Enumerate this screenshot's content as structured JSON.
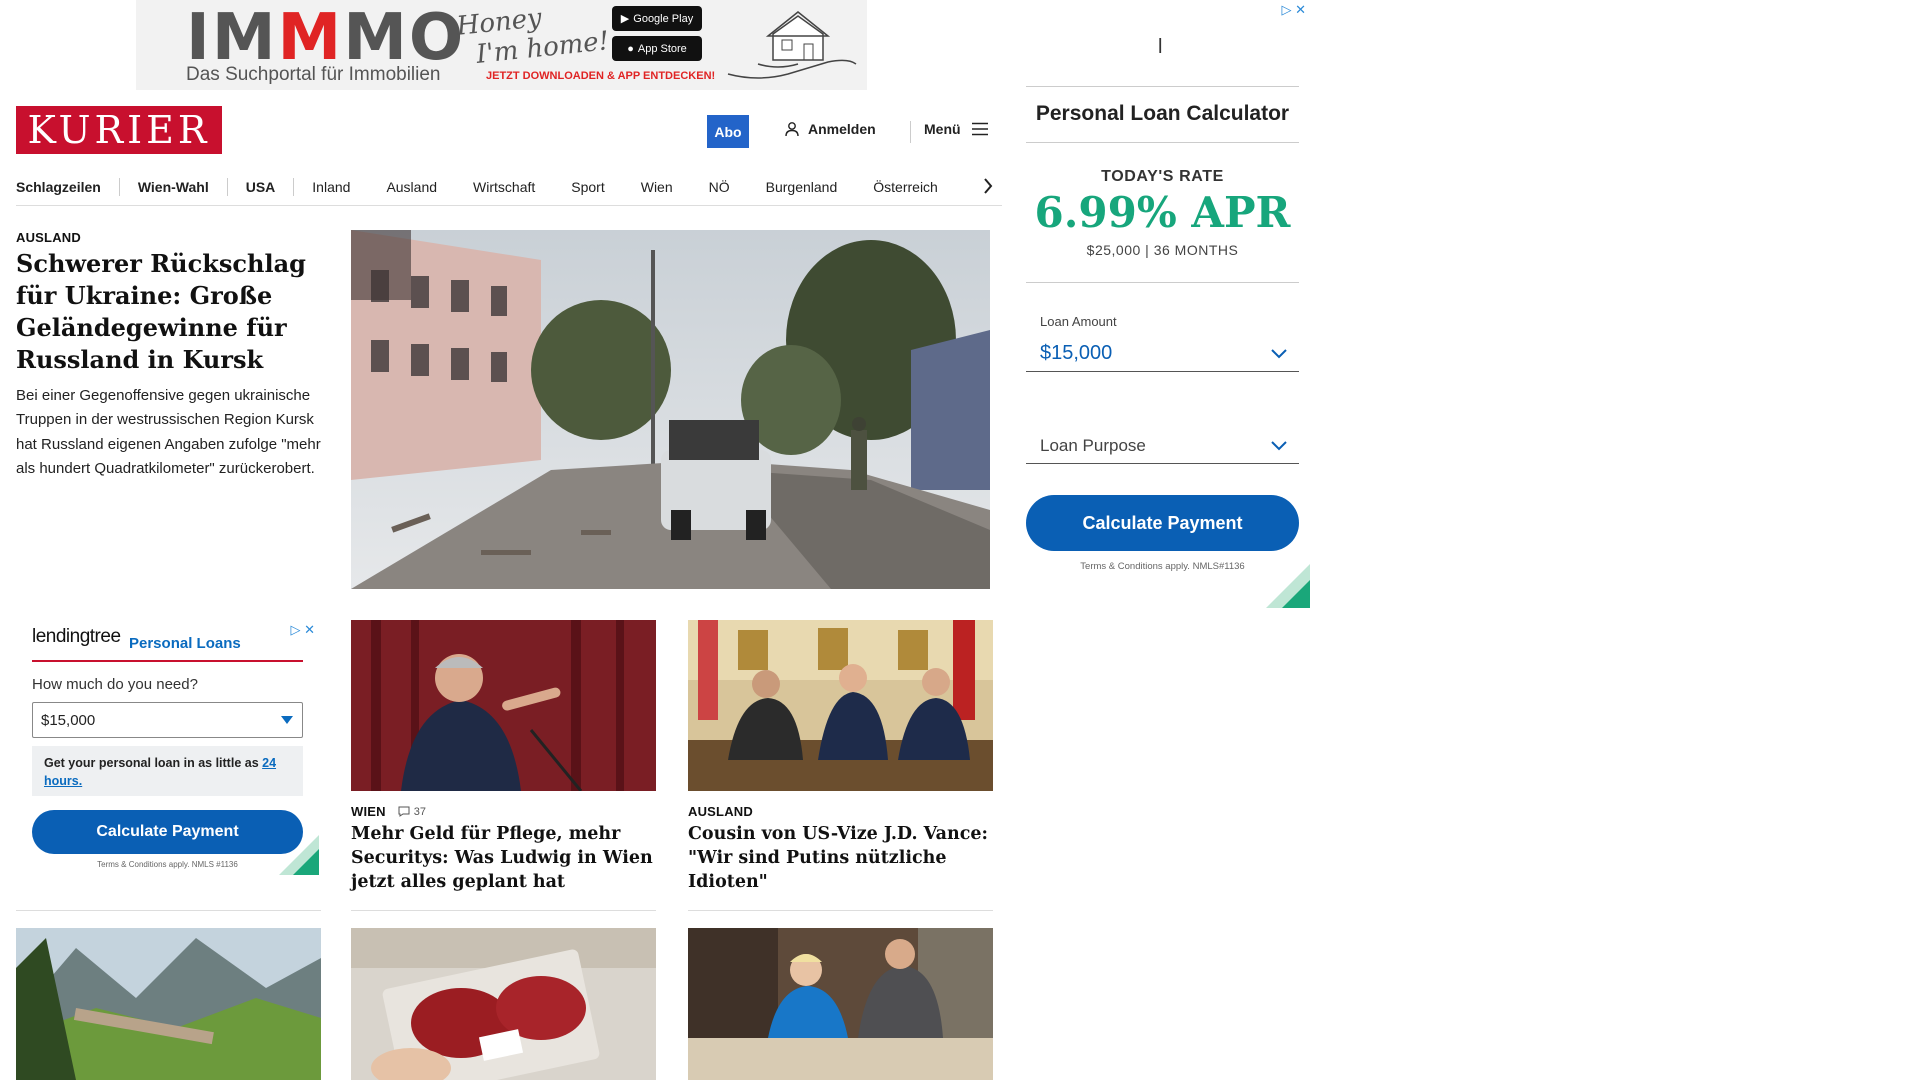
{
  "top_ad": {
    "brand_prefix": "IM",
    "brand_m": "M",
    "brand_suffix": "MO",
    "tagline": "Das Suchportal für Immobilien",
    "script_line1": "Honey",
    "script_line2": "I'm home!",
    "google_play": "Google Play",
    "app_store": "App Store",
    "cta": "JETZT DOWNLOADEN & APP ENTDECKEN!"
  },
  "header": {
    "logo": "KURIER",
    "abo": "Abo",
    "login": "Anmelden",
    "menu": "Menü"
  },
  "nav": {
    "items": [
      "Schlagzeilen",
      "Wien-Wahl",
      "USA",
      "Inland",
      "Ausland",
      "Wirtschaft",
      "Sport",
      "Wien",
      "NÖ",
      "Burgenland",
      "Österreich"
    ]
  },
  "lead": {
    "kicker": "AUSLAND",
    "title": "Schwerer Rückschlag für Ukraine: Große Geländegewinne für Russland in Kursk",
    "teaser": "Bei einer Gegenoffensive gegen ukrainische Truppen in der westrussischen Region Kursk hat Russland eigenen Angaben zufolge \"mehr als hundert Quadratkilometer\" zurückerobert."
  },
  "cards": [
    {
      "kicker": "WIEN",
      "comments": "37",
      "title": "Mehr Geld für Pflege, mehr Securitys: Was Ludwig in Wien jetzt alles geplant hat"
    },
    {
      "kicker": "AUSLAND",
      "title": "Cousin von US-Vize J.D. Vance: \"Wir sind Putins nützliche Idioten\""
    }
  ],
  "lt_ad": {
    "brand": "lendingtree",
    "product": "Personal Loans",
    "question": "How much do you need?",
    "amount": "$15,000",
    "info_text": "Get your personal loan in as little as ",
    "info_link": "24 hours.",
    "button": "Calculate Payment",
    "terms": "Terms & Conditions apply. NMLS #1136"
  },
  "side_ad": {
    "cursor": "l",
    "title": "Personal Loan Calculator",
    "rate_label": "TODAY'S RATE",
    "rate": "6.99% APR",
    "rate_sub": "$25,000 | 36 MONTHS",
    "amount_label": "Loan Amount",
    "amount": "$15,000",
    "purpose": "Loan Purpose",
    "button": "Calculate Payment",
    "terms": "Terms & Conditions apply. NMLS#1136"
  },
  "colors": {
    "kurier_red": "#c8102e",
    "abo_blue": "#2364c9",
    "ad_blue": "#0a5fb4",
    "rate_green": "#17a67c"
  }
}
